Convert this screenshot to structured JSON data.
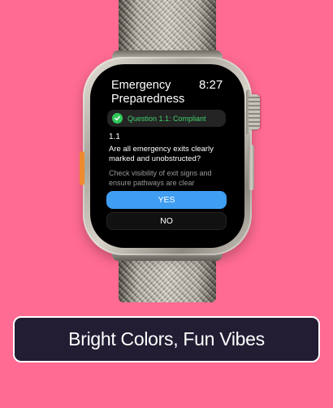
{
  "screen": {
    "title": "Emergency Preparedness",
    "time": "8:27",
    "status": {
      "icon": "checkmark-circle-icon",
      "text": "Question 1.1: Compliant",
      "color": "#30c85a"
    },
    "question": {
      "number": "1.1",
      "text": "Are all emergency exits clearly marked and unobstructed?",
      "hint": "Check visibility of exit signs and ensure pathways are clear"
    },
    "buttons": {
      "yes_label": "YES",
      "no_label": "NO",
      "yes_color": "#3f9df2"
    }
  },
  "caption": {
    "text": "Bright Colors, Fun Vibes"
  },
  "colors": {
    "background": "#ff6b92",
    "caption_background": "#221d33"
  }
}
